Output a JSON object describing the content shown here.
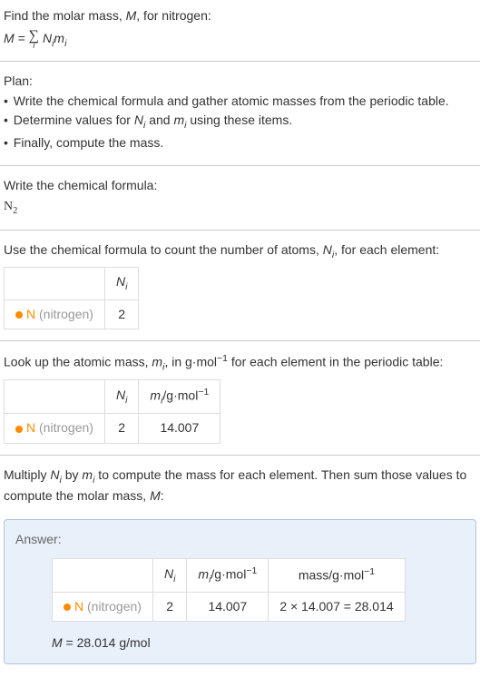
{
  "intro": {
    "text1": "Find the molar mass, ",
    "text2": ", for nitrogen:"
  },
  "plan": {
    "heading": "Plan:",
    "item1": "Write the chemical formula and gather atomic masses from the periodic table.",
    "item2_a": "Determine values for ",
    "item2_b": " and ",
    "item2_c": " using these items.",
    "item3": "Finally, compute the mass."
  },
  "step1": {
    "heading": "Write the chemical formula:",
    "formula_base": "N",
    "formula_sub": "2"
  },
  "step2": {
    "text_a": "Use the chemical formula to count the number of atoms, ",
    "text_b": ", for each element:"
  },
  "step3": {
    "text_a": "Look up the atomic mass, ",
    "text_b": ", in g·mol",
    "text_c": " for each element in the periodic table:"
  },
  "step4": {
    "text_a": "Multiply ",
    "text_b": " by ",
    "text_c": " to compute the mass for each element. Then sum those values to compute the molar mass, ",
    "text_d": ":"
  },
  "table_headers": {
    "Ni_sym": "N",
    "Ni_sub": "i",
    "mi_sym": "m",
    "mi_sub": "i",
    "per_gmol": "/g·mol",
    "neg1": "−1",
    "mass_label": "mass/g·mol"
  },
  "element": {
    "symbol": "N",
    "name": "(nitrogen)",
    "Ni": "2",
    "mi": "14.007",
    "mass_calc": "2 × 14.007 = 28.014"
  },
  "answer": {
    "label": "Answer:",
    "final_a": " = 28.014 g/mol"
  },
  "symbols": {
    "M": "M",
    "N": "N",
    "m": "m",
    "i": "i",
    "equals": " = ",
    "sigma": "∑",
    "bullet": "•"
  }
}
